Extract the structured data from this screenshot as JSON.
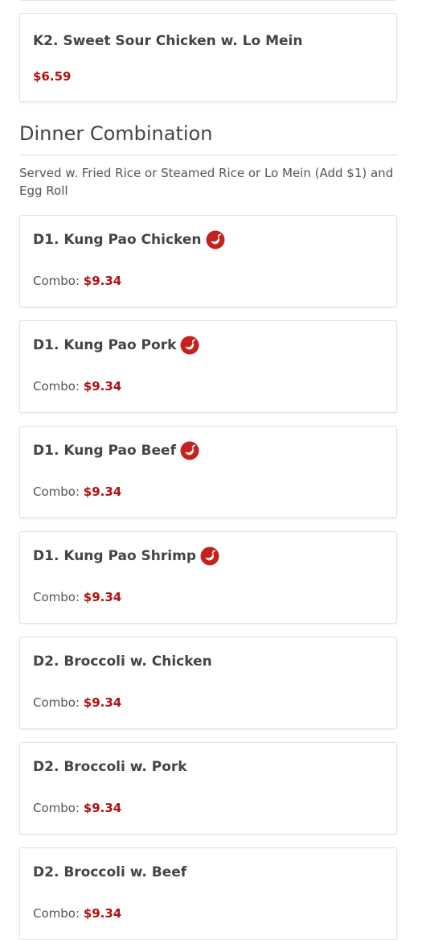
{
  "colors": {
    "price": "#b10f12",
    "spicy_icon": "#c5211d"
  },
  "previous_item": {
    "name": "K2. Sweet Sour Chicken w. Lo Mein",
    "price": "$6.59"
  },
  "section": {
    "title": "Dinner Combination",
    "description": "Served w. Fried Rice or Steamed Rice or Lo Mein (Add $1) and Egg Roll"
  },
  "items": [
    {
      "name": "D1. Kung Pao Chicken",
      "spicy": true,
      "price_label": "Combo:",
      "price": "$9.34",
      "icon": "chili-pepper-icon"
    },
    {
      "name": "D1. Kung Pao Pork",
      "spicy": true,
      "price_label": "Combo:",
      "price": "$9.34",
      "icon": "chili-pepper-icon"
    },
    {
      "name": "D1. Kung Pao Beef",
      "spicy": true,
      "price_label": "Combo:",
      "price": "$9.34",
      "icon": "chili-pepper-icon"
    },
    {
      "name": "D1. Kung Pao Shrimp",
      "spicy": true,
      "price_label": "Combo:",
      "price": "$9.34",
      "icon": "chili-pepper-icon"
    },
    {
      "name": "D2. Broccoli w. Chicken",
      "spicy": false,
      "price_label": "Combo:",
      "price": "$9.34"
    },
    {
      "name": "D2. Broccoli w. Pork",
      "spicy": false,
      "price_label": "Combo:",
      "price": "$9.34"
    },
    {
      "name": "D2. Broccoli w. Beef",
      "spicy": false,
      "price_label": "Combo:",
      "price": "$9.34"
    }
  ]
}
